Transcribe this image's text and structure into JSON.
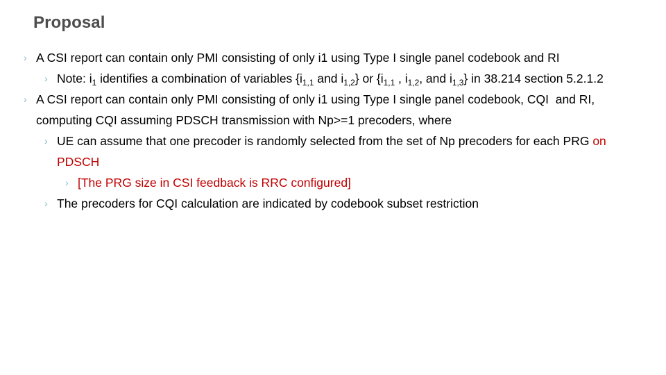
{
  "slide": {
    "title": "Proposal",
    "title_color": "#4d4d4d",
    "bullet_marker": "›",
    "bullet_marker_color": "#7fb8c4",
    "accent_red": "#C00000",
    "background": "#ffffff",
    "body_text_color": "#000000"
  },
  "bullets": [
    {
      "level": 1,
      "icon": "chevron-right-icon",
      "text": "A CSI report can contain only PMI consisting of only i1 using Type I single panel codebook and RI"
    },
    {
      "level": 2,
      "icon": "chevron-right-icon",
      "text_parts": {
        "p1": "Note: i",
        "sub1": "1",
        "p2": " identifies a combination of variables {i",
        "sub2": "1,1",
        "p3": " and i",
        "sub3": "1,2",
        "p4": "} or {i",
        "sub4": "1,1",
        "p5": " , i",
        "sub5": "1,2",
        "p6": ", and i",
        "sub6": "1,3",
        "p7": "} in 38.214 section 5.2.1.2"
      },
      "text": "Note: i1 identifies a combination of variables {i1,1 and i1,2} or {i1,1 , i1,2, and i1,3} in 38.214 section 5.2.1.2"
    },
    {
      "level": 1,
      "icon": "chevron-right-icon",
      "text": "A CSI report can contain only PMI consisting of only i1 using Type I single panel codebook, CQI  and RI, computing CQI assuming PDSCH transmission with Np>=1 precoders, where"
    },
    {
      "level": 2,
      "icon": "chevron-right-icon",
      "text_black": "UE can assume that one precoder is randomly selected from the set of Np precoders for each PRG ",
      "text_red": "on PDSCH",
      "text": "UE can assume that one precoder is randomly selected from the set of Np precoders for each PRG on PDSCH"
    },
    {
      "level": 3,
      "icon": "chevron-right-icon",
      "text": "[The PRG size in CSI feedback is RRC configured]",
      "color": "red"
    },
    {
      "level": 2,
      "icon": "chevron-right-icon",
      "text": "The precoders for CQI calculation are indicated by codebook subset restriction"
    }
  ]
}
